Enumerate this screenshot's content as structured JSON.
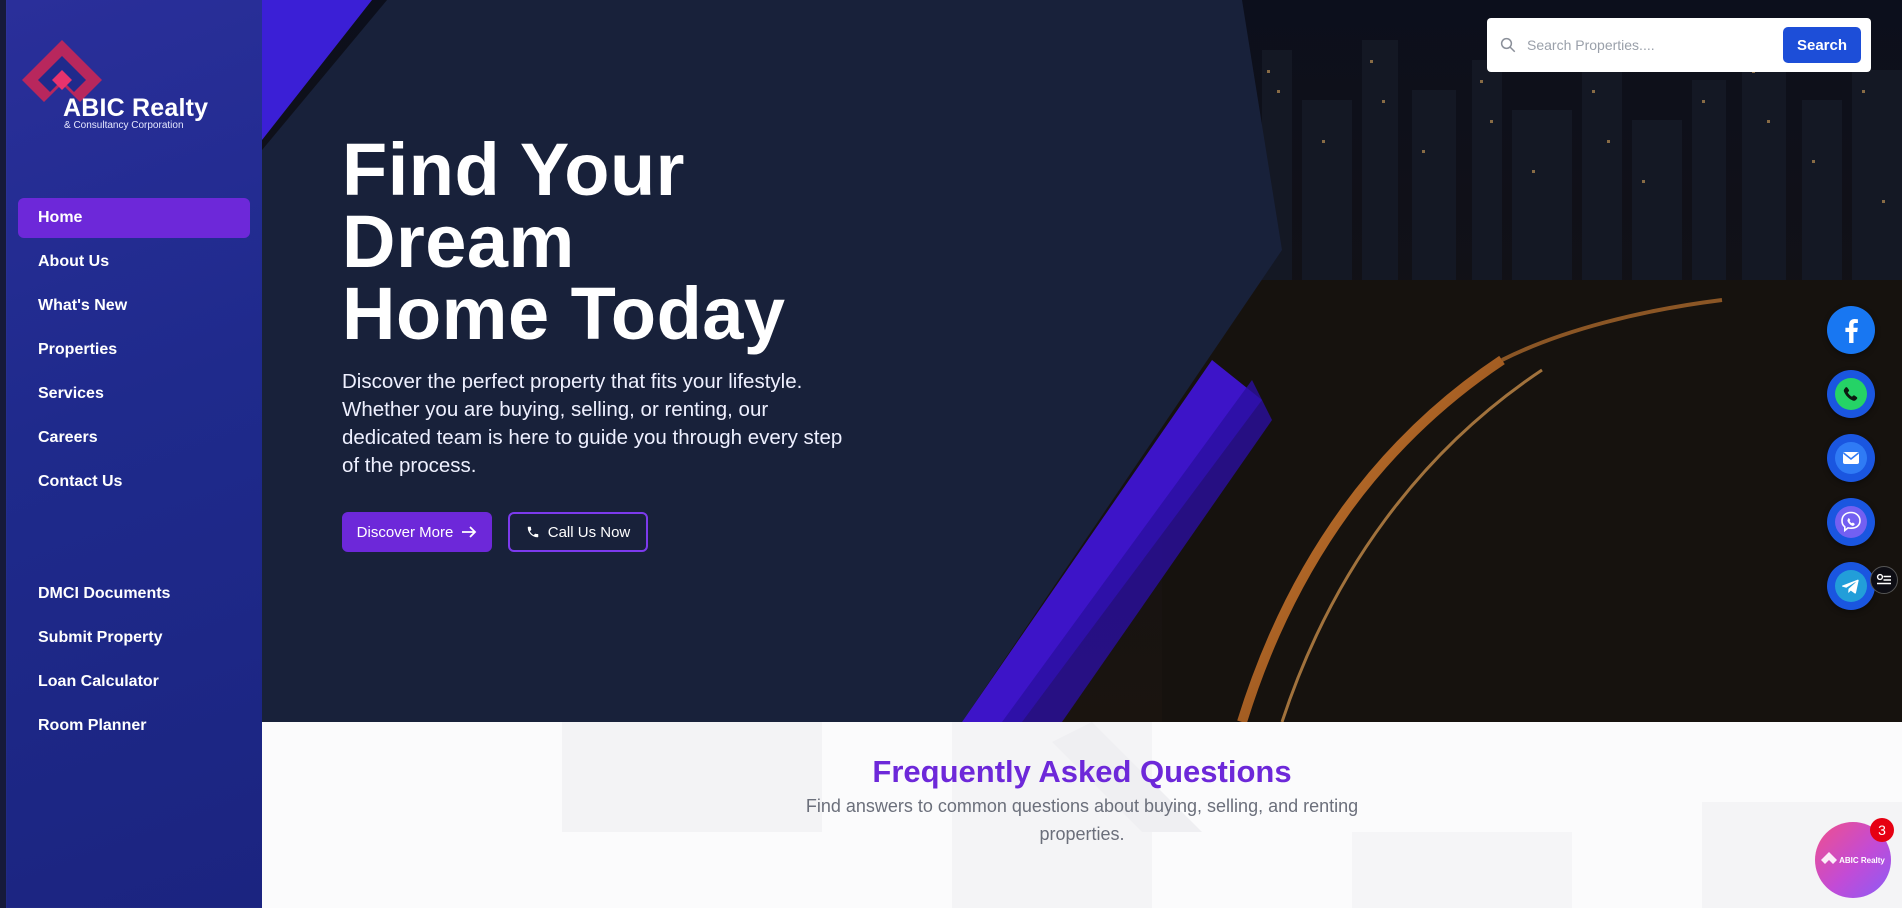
{
  "brand": {
    "title": "ABIC Realty",
    "subtitle": "& Consultancy Corporation"
  },
  "nav": {
    "primary": [
      {
        "label": "Home",
        "active": true
      },
      {
        "label": "About Us"
      },
      {
        "label": "What's New"
      },
      {
        "label": "Properties"
      },
      {
        "label": "Services"
      },
      {
        "label": "Careers"
      },
      {
        "label": "Contact Us"
      }
    ],
    "secondary": [
      {
        "label": "DMCI Documents"
      },
      {
        "label": "Submit Property"
      },
      {
        "label": "Loan Calculator"
      },
      {
        "label": "Room Planner"
      }
    ]
  },
  "search": {
    "placeholder": "Search Properties....",
    "button_label": "Search"
  },
  "hero": {
    "title_lines": [
      "Find Your",
      "Dream",
      "Home Today"
    ],
    "description": "Discover the perfect property that fits your lifestyle. Whether you are buying, selling, or renting, our dedicated team is here to guide you through every step of the process.",
    "primary_button": "Discover More",
    "secondary_button": "Call Us Now"
  },
  "social": [
    {
      "name": "facebook",
      "icon": "facebook-icon",
      "color": "#1877f2"
    },
    {
      "name": "whatsapp",
      "icon": "phone-icon",
      "color": "#25d366"
    },
    {
      "name": "email",
      "icon": "mail-icon",
      "color": "#1e6ff0"
    },
    {
      "name": "viber",
      "icon": "viber-icon",
      "color": "#7360f2"
    },
    {
      "name": "telegram",
      "icon": "send-icon",
      "color": "#229ed9"
    }
  ],
  "faq": {
    "title": "Frequently Asked Questions",
    "subtitle": "Find answers to common questions about buying, selling, and renting properties."
  },
  "chat": {
    "badge_count": "3",
    "logo_text": "ABIC Realty"
  },
  "colors": {
    "accent": "#6d28d9",
    "sidebar": "#1f2a8c",
    "search_button": "#1d4ed8"
  }
}
